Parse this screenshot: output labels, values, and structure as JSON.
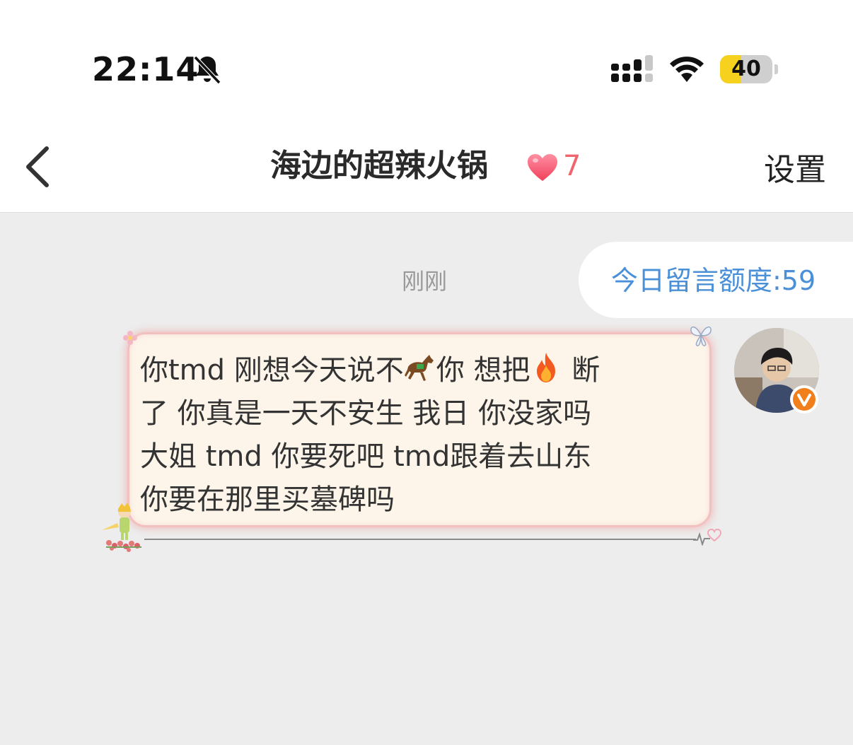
{
  "status_bar": {
    "time": "22:14",
    "battery_level": "40",
    "battery_fraction": 0.4
  },
  "nav": {
    "title": "海边的超辣火锅",
    "heart_count": "7",
    "settings_label": "设置"
  },
  "chat": {
    "quota_text": "今日留言额度:59",
    "timestamp": "刚刚",
    "message": {
      "line1_a": "你tmd 刚想今天说不",
      "line1_b": "你 想把",
      "line1_c": "断",
      "line2": "了 你真是一天不安生 我日 你没家吗",
      "line3": "大姐 tmd 你要死吧 tmd跟着去山东",
      "line4": "你要在那里买墓碑吗",
      "emojis": [
        "horse-emoji",
        "fire-emoji"
      ]
    }
  },
  "colors": {
    "background": "#ededed",
    "quota_blue": "#4a90d9",
    "heart_pink": "#f0646e",
    "bubble_bg": "#fdf5ea",
    "bubble_border": "#f3c0c0",
    "badge_orange": "#f07f1c"
  }
}
